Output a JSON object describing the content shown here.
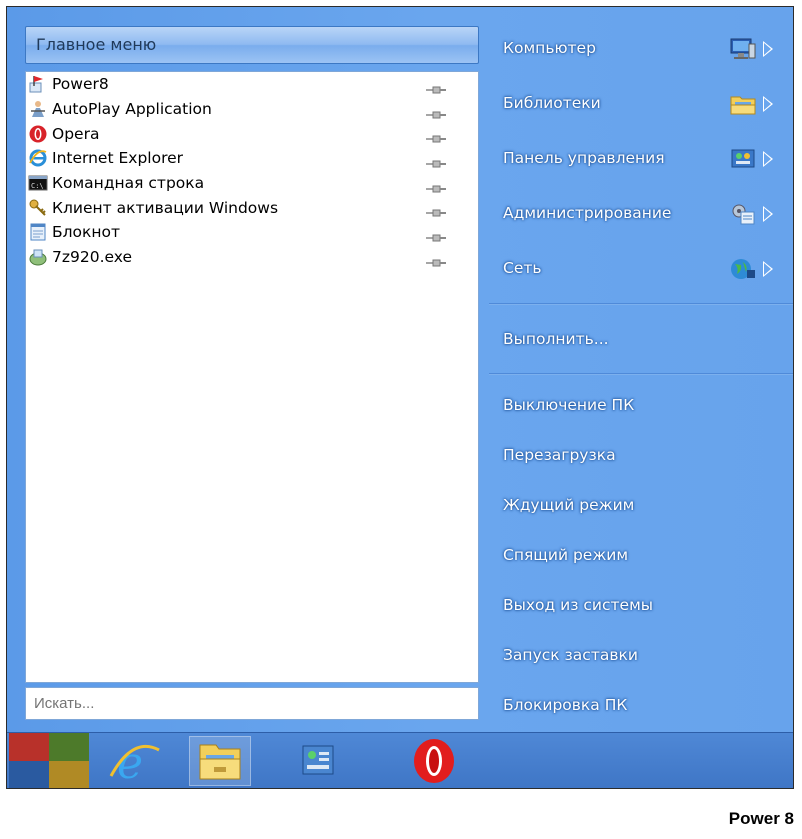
{
  "left_pane": {
    "header": "Главное меню",
    "programs": [
      {
        "label": "Power8",
        "icon": "power8-flag-icon"
      },
      {
        "label": "AutoPlay Application",
        "icon": "autoplay-icon"
      },
      {
        "label": "Opera",
        "icon": "opera-icon"
      },
      {
        "label": "Internet Explorer",
        "icon": "internet-explorer-icon"
      },
      {
        "label": "Командная строка",
        "icon": "command-prompt-icon"
      },
      {
        "label": "Клиент активации Windows",
        "icon": "activation-key-icon"
      },
      {
        "label": "Блокнот",
        "icon": "notepad-icon"
      },
      {
        "label": "7z920.exe",
        "icon": "installer-icon"
      }
    ],
    "search_placeholder": "Искать..."
  },
  "right_pane": {
    "places": [
      {
        "label": "Компьютер",
        "icon": "computer-icon"
      },
      {
        "label": "Библиотеки",
        "icon": "libraries-folder-icon"
      },
      {
        "label": "Панель управления",
        "icon": "control-panel-icon"
      },
      {
        "label": "Администрирование",
        "icon": "admin-tools-icon"
      },
      {
        "label": "Сеть",
        "icon": "network-globe-icon"
      }
    ],
    "run": "Выполнить...",
    "power": [
      "Выключение ПК",
      "Перезагрузка",
      "Ждущий режим",
      "Спящий режим",
      "Выход из системы",
      "Запуск заставки",
      "Блокировка ПК"
    ]
  },
  "taskbar": {
    "items": [
      "start-tiles-icon",
      "internet-explorer-icon",
      "file-explorer-icon",
      "control-panel-icon",
      "opera-icon"
    ]
  },
  "brand": "Power 8",
  "colors": {
    "menu_bg": "#6aa6ee",
    "taskbar_bg": "#4479c9",
    "text_right": "#ffffff"
  }
}
